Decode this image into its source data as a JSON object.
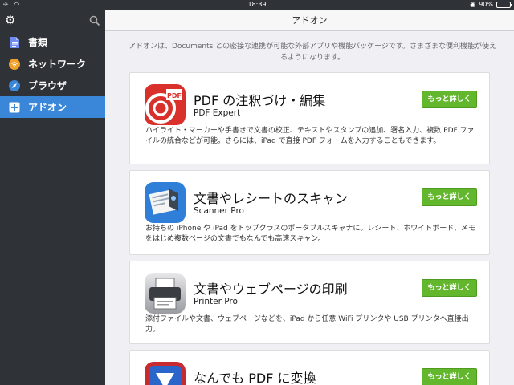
{
  "status": {
    "left": "✈ ◠",
    "time": "18:39",
    "battery": "90%",
    "battery_level": 0.9
  },
  "sidebar": {
    "items": [
      {
        "label": "書類",
        "icon": "document-icon"
      },
      {
        "label": "ネットワーク",
        "icon": "wifi-icon"
      },
      {
        "label": "ブラウザ",
        "icon": "compass-icon"
      },
      {
        "label": "アドオン",
        "icon": "plus-icon"
      }
    ]
  },
  "main": {
    "title": "アドオン",
    "intro": "アドオンは、Documents との密接な連携が可能な外部アプリや機能パッケージです。さまざまな便利機能が使えるようになります。",
    "cards": [
      {
        "title": "PDF の注釈づけ・編集",
        "subtitle": "PDF Expert",
        "button": "もっと詳しく",
        "desc": "ハイライト・マーカーや手書きで文書の校正、テキストやスタンプの追加、署名入力、複数 PDF ファイルの統合などが可能。さらには、iPad で直接 PDF フォームを入力することもできます。",
        "icon_text": "PDF"
      },
      {
        "title": "文書やレシートのスキャン",
        "subtitle": "Scanner Pro",
        "button": "もっと詳しく",
        "desc": "お持ちの iPhone や iPad をトップクラスのポータブルスキャナに。レシート、ホワイトボード、メモをはじめ複数ページの文書でもなんでも高速スキャン。"
      },
      {
        "title": "文書やウェブページの印刷",
        "subtitle": "Printer Pro",
        "button": "もっと詳しく",
        "desc": "添付ファイルや文書、ウェブページなどを、iPad から任意 WiFi プリンタや USB プリンタへ直接出力。"
      },
      {
        "title": "なんでも PDF に変換",
        "button": "もっと詳しく"
      }
    ]
  },
  "colors": {
    "sidebar": "#2f3236",
    "active": "#3a86d8",
    "button": "#63b72d",
    "pdf_red": "#d9302c"
  }
}
